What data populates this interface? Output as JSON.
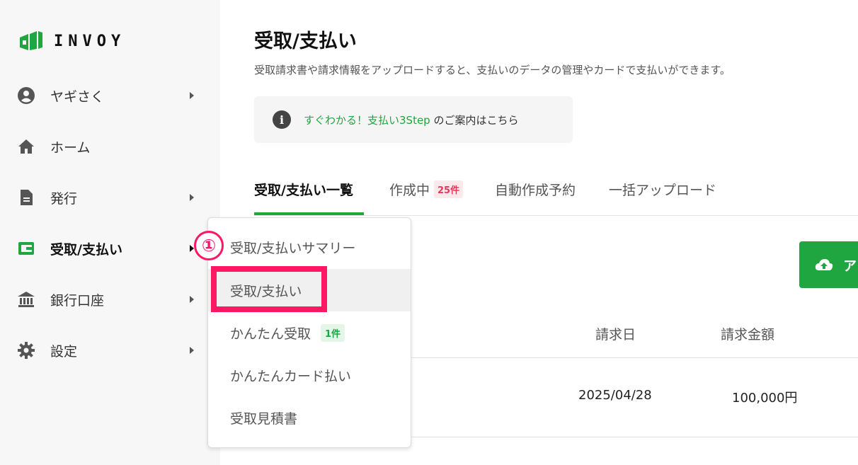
{
  "brand": {
    "name": "INVOY",
    "color": "#1fa640"
  },
  "sidebar": {
    "items": [
      {
        "label": "ヤギさく",
        "icon": "user-circle-icon",
        "has_submenu": true
      },
      {
        "label": "ホーム",
        "icon": "home-icon",
        "has_submenu": false
      },
      {
        "label": "発行",
        "icon": "document-icon",
        "has_submenu": true
      },
      {
        "label": "受取/支払い",
        "icon": "wallet-icon",
        "has_submenu": true,
        "active": true
      },
      {
        "label": "銀行口座",
        "icon": "bank-icon",
        "has_submenu": true
      },
      {
        "label": "設定",
        "icon": "gear-icon",
        "has_submenu": true
      }
    ]
  },
  "page": {
    "title": "受取/支払い",
    "description": "受取請求書や請求情報をアップロードすると、支払いのデータの管理やカードで支払いができます。",
    "info": {
      "link_text": "すぐわかる！支払い3Step",
      "suffix": " のご案内はこちら"
    }
  },
  "tabs": [
    {
      "label": "受取/支払い一覧",
      "active": true
    },
    {
      "label": "作成中",
      "badge": "25件"
    },
    {
      "label": "自動作成予約"
    },
    {
      "label": "一括アップロード"
    }
  ],
  "upload_button": {
    "label": "ア"
  },
  "table": {
    "headers": [
      "請求日",
      "請求金額"
    ],
    "rows": [
      {
        "date": "2025/04/28",
        "amount": "100,000円"
      }
    ]
  },
  "submenu": {
    "items": [
      {
        "label": "受取/支払いサマリー"
      },
      {
        "label": "受取/支払い",
        "selected": true
      },
      {
        "label": "かんたん受取",
        "badge": "1件"
      },
      {
        "label": "かんたんカード払い"
      },
      {
        "label": "受取見積書"
      }
    ]
  },
  "annotation": {
    "step_marker": "①",
    "highlight_color": "#ff1763"
  }
}
